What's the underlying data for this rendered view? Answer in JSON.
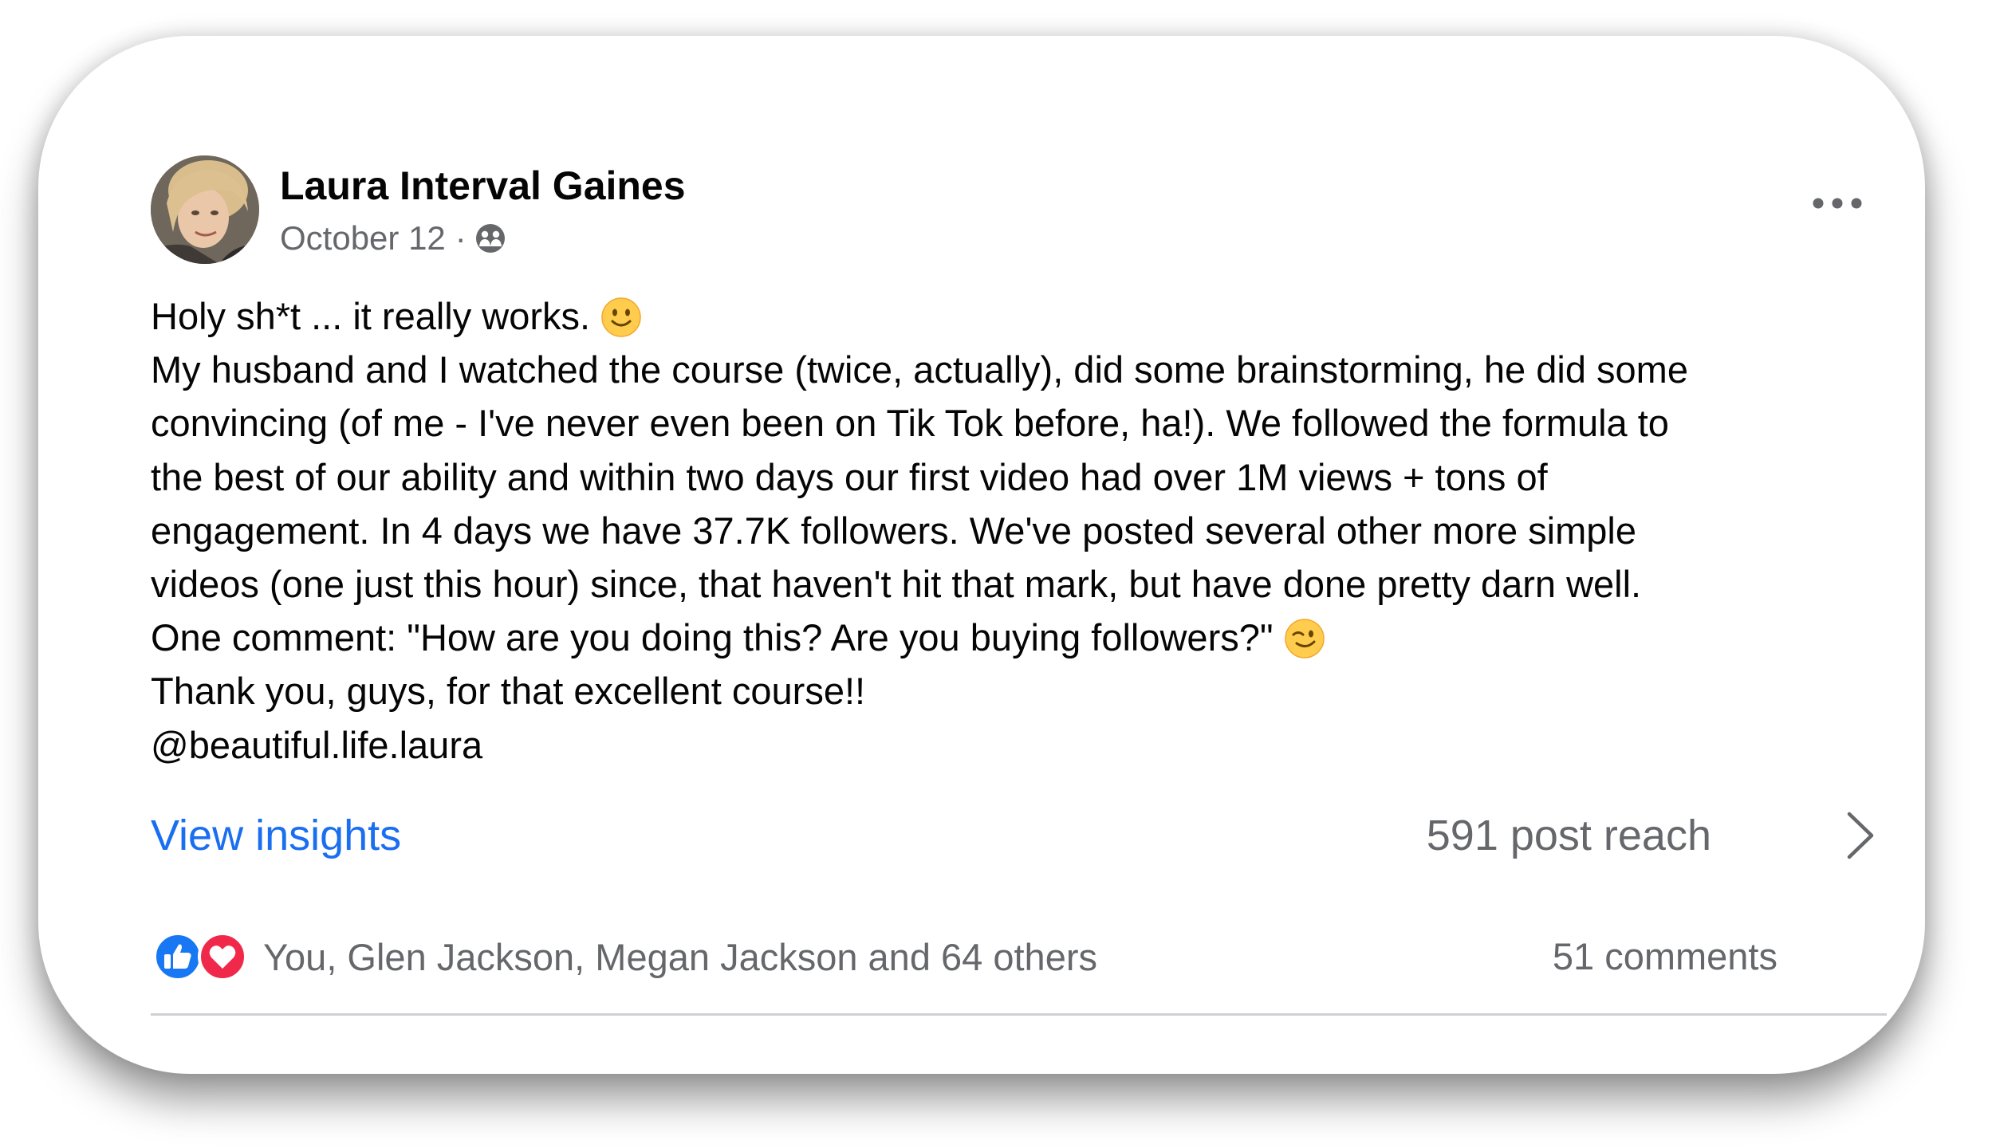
{
  "post": {
    "author": "Laura Interval Gaines",
    "date": "October 12",
    "separator": "·",
    "privacy_icon": "friends-icon",
    "menu_icon": "more-options-icon",
    "lines": [
      "Holy sh*t ... it really works.",
      "My husband and I watched the course (twice, actually), did some brainstorming, he did some",
      "convincing (of me - I've never even been on Tik Tok before, ha!). We followed the formula to",
      "the best of our ability and within two days our first video had over 1M views + tons of",
      "engagement. In 4 days we have 37.7K followers. We've posted several other more simple",
      "videos (one just this hour) since, that haven't hit that mark, but have done pretty darn well.",
      "One comment: \"How are you doing this? Are you buying followers?\"",
      "Thank you, guys, for that excellent course!!",
      "@beautiful.life.laura"
    ],
    "emoji_line1": "slightly-smiling-face",
    "emoji_line7": "winking-face"
  },
  "insights": {
    "link_label": "View insights",
    "reach_label": "591 post reach"
  },
  "engagement": {
    "reactors": "You, Glen Jackson, Megan Jackson and 64 others",
    "comments": "51 comments",
    "reaction_icons": [
      "like-icon",
      "love-icon"
    ]
  },
  "colors": {
    "link_blue": "#1a6ef0",
    "text_primary": "#050505",
    "text_secondary": "#65676b",
    "like_blue": "#1877f2",
    "love_red": "#f0284a"
  }
}
